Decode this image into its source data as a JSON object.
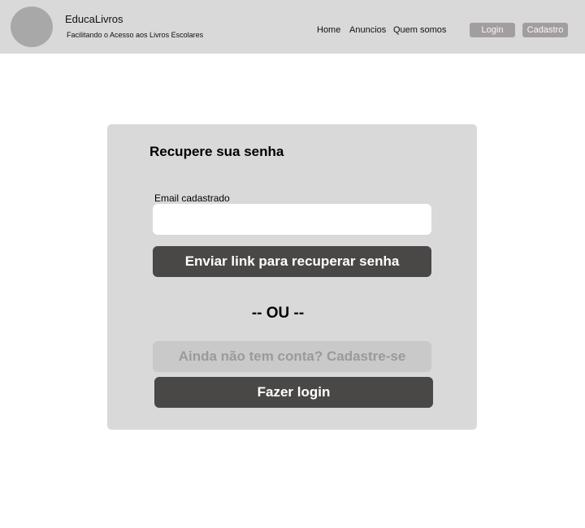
{
  "header": {
    "brand_name": "EducaLivros",
    "tagline": "Facilitando o Acesso aos Livros Escolares",
    "nav": {
      "home": "Home",
      "anuncios": "Anuncios",
      "quem_somos": "Quem somos"
    },
    "login_label": "Login",
    "cadastro_label": "Cadastro"
  },
  "recovery": {
    "title": "Recupere sua senha",
    "email_label": "Email cadastrado",
    "email_value": "",
    "send_link_label": "Enviar link para recuperar senha",
    "divider": "-- OU --",
    "signup_label": "Ainda não tem conta? Cadastre-se",
    "login_label": "Fazer login"
  },
  "colors": {
    "header_bg": "#d9d9d9",
    "card_bg": "#d9d9d9",
    "dark_button": "#4a4747",
    "header_button": "#a39e9e"
  }
}
